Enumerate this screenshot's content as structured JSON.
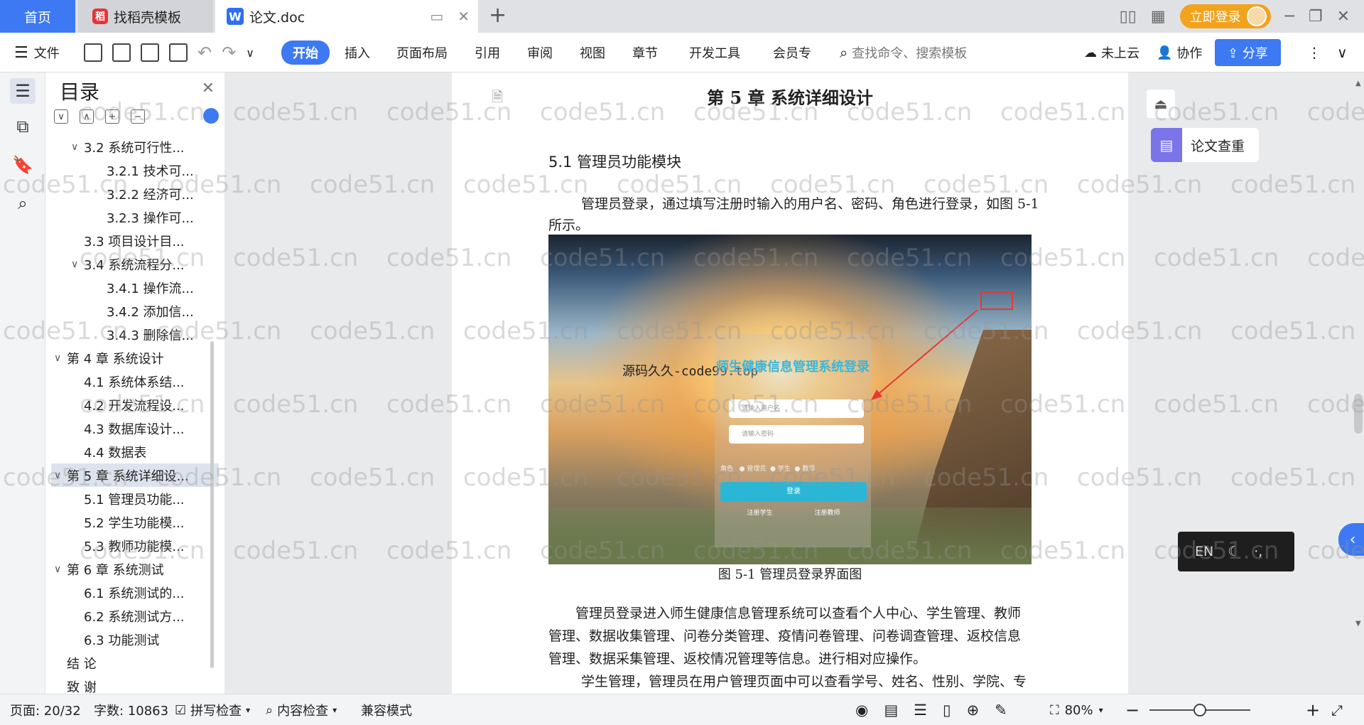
{
  "tabs": {
    "home": "首页",
    "templates": "找稻壳模板",
    "doc": "论文.doc"
  },
  "window": {
    "login_label": "立即登录"
  },
  "toolbar": {
    "file": "文件",
    "start": "开始",
    "insert": "插入",
    "page_layout": "页面布局",
    "reference": "引用",
    "review": "审阅",
    "view": "视图",
    "chapter": "章节",
    "dev_tools": "开发工具",
    "member": "会员专",
    "search_placeholder": "查找命令、搜索模板",
    "cloud": "未上云",
    "collab": "协作",
    "share": "分享"
  },
  "toc": {
    "title": "目录",
    "items": [
      {
        "label": "3.2 系统可行性...",
        "level": 2,
        "caret": "∨"
      },
      {
        "label": "3.2.1 技术可...",
        "level": 3,
        "caret": ""
      },
      {
        "label": "3.2.2 经济可...",
        "level": 3,
        "caret": ""
      },
      {
        "label": "3.2.3 操作可...",
        "level": 3,
        "caret": ""
      },
      {
        "label": "3.3 项目设计目...",
        "level": 2,
        "caret": ""
      },
      {
        "label": "3.4 系统流程分...",
        "level": 2,
        "caret": "∨"
      },
      {
        "label": "3.4.1 操作流...",
        "level": 3,
        "caret": ""
      },
      {
        "label": "3.4.2 添加信...",
        "level": 3,
        "caret": ""
      },
      {
        "label": "3.4.3 删除信...",
        "level": 3,
        "caret": ""
      },
      {
        "label": "第 4 章 系统设计",
        "level": 1,
        "caret": "∨"
      },
      {
        "label": "4.1 系统体系结...",
        "level": 2,
        "caret": ""
      },
      {
        "label": "4.2 开发流程设...",
        "level": 2,
        "caret": ""
      },
      {
        "label": "4.3 数据库设计...",
        "level": 2,
        "caret": ""
      },
      {
        "label": "4.4 数据表",
        "level": 2,
        "caret": ""
      },
      {
        "label": "第 5 章 系统详细设...",
        "level": 1,
        "caret": "∨",
        "active": true
      },
      {
        "label": "5.1 管理员功能...",
        "level": 2,
        "caret": ""
      },
      {
        "label": "5.2 学生功能模...",
        "level": 2,
        "caret": ""
      },
      {
        "label": "5.3 教师功能模...",
        "level": 2,
        "caret": ""
      },
      {
        "label": "第 6 章 系统测试",
        "level": 1,
        "caret": "∨"
      },
      {
        "label": "6.1 系统测试的...",
        "level": 2,
        "caret": ""
      },
      {
        "label": "6.2 系统测试方...",
        "level": 2,
        "caret": ""
      },
      {
        "label": "6.3 功能测试",
        "level": 2,
        "caret": ""
      },
      {
        "label": "结 论",
        "level": 1,
        "caret": ""
      },
      {
        "label": "致 谢",
        "level": 1,
        "caret": ""
      }
    ]
  },
  "doc": {
    "chapter_title": "第 5 章  系统详细设计",
    "section_title": "5.1 管理员功能模块",
    "para1_line1": "管理员登录，通过填写注册时输入的用户名、密码、角色进行登录，如图 5-1",
    "para1_line2": "所示。",
    "figure": {
      "watermark": "源码久久-code99.top",
      "login_title": "师生健康信息管理系统登录",
      "username_placeholder": "请输入用户名",
      "password_placeholder": "请输入密码",
      "role_label": "角色",
      "roles": [
        "管理员",
        "学生",
        "教师"
      ],
      "submit": "登录",
      "link_student": "注册学生",
      "link_teacher": "注册教师"
    },
    "caption": "图 5-1 管理员登录界面图",
    "para2_line1": "管理员登录进入师生健康信息管理系统可以查看个人中心、学生管理、教师",
    "para2_line2": "管理、数据收集管理、问卷分类管理、疫情问卷管理、问卷调查管理、返校信息",
    "para2_line3": "管理、数据采集管理、返校情况管理等信息。进行相对应操作。",
    "para3_line1": "学生管理，管理员在用户管理页面中可以查看学号、姓名、性别、学院、专"
  },
  "right_panel": {
    "check_label": "论文查重",
    "ime_lang": "EN"
  },
  "status": {
    "page": "页面: 20/32",
    "words": "字数: 10863",
    "spell": "拼写检查",
    "content_check": "内容检查",
    "compat": "兼容模式",
    "zoom": "80%",
    "zoom_level": 0.5
  },
  "watermark_text": "code51.cn"
}
